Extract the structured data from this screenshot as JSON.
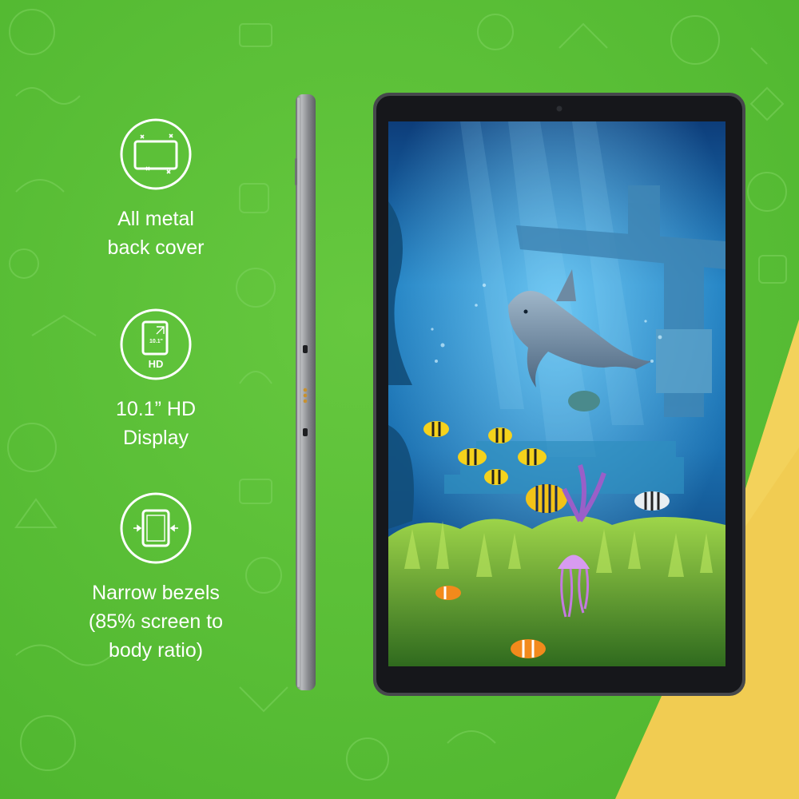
{
  "colors": {
    "background_green": "#5cc23a",
    "accent_yellow": "#f1cc52",
    "tablet_frame": "#46484c",
    "tablet_bezel": "#16171b",
    "side_metal": "#8d8f93",
    "icon_white": "#ffffff"
  },
  "features": [
    {
      "icon": "metal-back-cover-icon",
      "label_line1": "All metal",
      "label_line2": "back cover"
    },
    {
      "icon": "hd-display-icon",
      "icon_text_size": "10.1\"",
      "icon_text_hd": "HD",
      "label_line1": "10.1” HD",
      "label_line2": "Display"
    },
    {
      "icon": "narrow-bezel-icon",
      "label_line1": "Narrow bezels",
      "label_line2": "(85% screen to",
      "label_line3": "body ratio)"
    }
  ],
  "product": {
    "side_view": "tablet-side-profile",
    "front_view": "tablet-front",
    "screen_wallpaper": "underwater-scene-with-dolphin-and-fish"
  }
}
